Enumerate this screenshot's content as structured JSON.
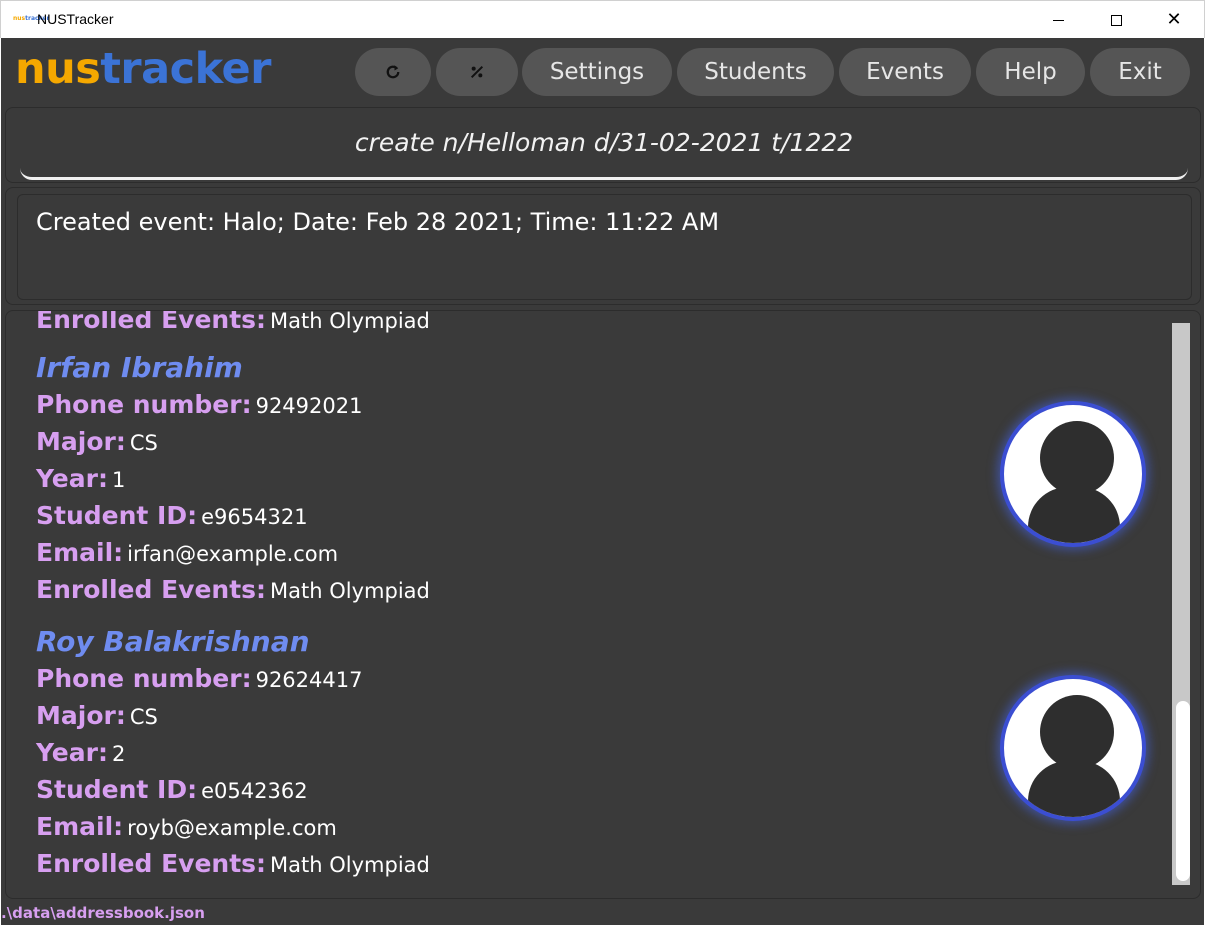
{
  "window": {
    "title": "NUSTracker",
    "icon_text_a": "nus",
    "icon_text_b": "tracker"
  },
  "header": {
    "logo_nus": "nus",
    "logo_tracker": "tracker",
    "buttons": {
      "refresh_icon": "refresh-icon",
      "theme_icon": "theme-toggle-icon",
      "settings": "Settings",
      "students": "Students",
      "events": "Events",
      "help": "Help",
      "exit": "Exit"
    }
  },
  "command": {
    "value": "create n/Helloman d/31-02-2021 t/1222"
  },
  "result": {
    "text": "Created event: Halo; Date: Feb 28 2021; Time: 11:22 AM"
  },
  "students": {
    "partial_row": {
      "label": "Enrolled Events:",
      "value": "Math Olympiad"
    },
    "cards": [
      {
        "name": "Irfan Ibrahim",
        "phone_label": "Phone number:",
        "phone": "92492021",
        "major_label": "Major:",
        "major": "CS",
        "year_label": "Year:",
        "year": "1",
        "id_label": "Student ID:",
        "id": "e9654321",
        "email_label": "Email:",
        "email": "irfan@example.com",
        "events_label": "Enrolled Events:",
        "events": "Math Olympiad"
      },
      {
        "name": "Roy Balakrishnan",
        "phone_label": "Phone number:",
        "phone": "92624417",
        "major_label": "Major:",
        "major": "CS",
        "year_label": "Year:",
        "year": "2",
        "id_label": "Student ID:",
        "id": "e0542362",
        "email_label": "Email:",
        "email": "royb@example.com",
        "events_label": "Enrolled Events:",
        "events": "Math Olympiad"
      }
    ]
  },
  "status": {
    "path": ".\\data\\addressbook.json"
  },
  "colors": {
    "background": "#3a3a3a",
    "logo_nus": "#f5a800",
    "logo_tracker": "#3b73d6",
    "name": "#6f8cf0",
    "label": "#d79ff0",
    "avatar_ring": "#3b4ed2"
  }
}
